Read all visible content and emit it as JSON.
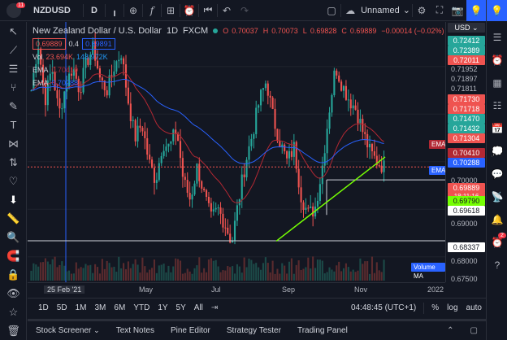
{
  "toolbar": {
    "symbol": "NZDUSD",
    "interval": "D",
    "layout_name": "Unnamed",
    "layout_caret": "⌄"
  },
  "notifications_count": "11",
  "legend": {
    "title": "New Zealand Dollar / U.S. Dollar",
    "interval": "1D",
    "exchange": "FXCM",
    "open_label": "O",
    "open": "0.70037",
    "high_label": "H",
    "high": "0.70073",
    "low_label": "L",
    "low": "0.69828",
    "close_label": "C",
    "close": "0.69889",
    "change": "−0.00014 (−0.02%)",
    "bid": "0.69889",
    "spread": "0.4",
    "ask": "0.69891",
    "vol_label": "Vol",
    "vol_value": "23.694K",
    "vol_ma": "148.972K",
    "ema1_label": "EMA",
    "ema1_value": "0.70410",
    "ema2_label": "EMA",
    "ema2_value": "0.70288"
  },
  "price_axis": {
    "currency": "USD",
    "red_labels": [
      "0.72011",
      "0.71730",
      "0.71718",
      "0.71304"
    ],
    "green_labels": [
      "0.72412",
      "0.72389",
      "0.71470",
      "0.71432"
    ],
    "plain_labels": [
      "0.71952",
      "0.71897",
      "0.71811"
    ],
    "ema_red": "0.70410",
    "ema_blue": "0.70288",
    "tick_700": "0.70000",
    "last_price": "0.69889",
    "countdown": "18:11:16",
    "green_last": "0.69790",
    "hline1": "0.69618",
    "tick_690": "0.69000",
    "hline2": "0.68337",
    "tick_680": "0.68000",
    "tick_675": "0.67500"
  },
  "overlay_tags": {
    "ema": "EMA",
    "volume_ma": "Volume MA"
  },
  "time_axis": [
    "25 Feb '21",
    "May",
    "Jul",
    "Sep",
    "Nov",
    "2022"
  ],
  "ranges": [
    "1D",
    "5D",
    "1M",
    "3M",
    "6M",
    "YTD",
    "1Y",
    "5Y",
    "All"
  ],
  "bottom_right": {
    "clock": "04:48:45 (UTC+1)",
    "percent": "%",
    "log": "log",
    "auto": "auto"
  },
  "panels": [
    "Stock Screener",
    "Text Notes",
    "Pine Editor",
    "Strategy Tester",
    "Trading Panel"
  ],
  "alerts_badge": "2",
  "colors": {
    "bg": "#131722",
    "up": "#26a69a",
    "down": "#ef5350",
    "ema_red": "#b22833",
    "ema_blue": "#2962ff",
    "trendline": "#76ff03",
    "hline": "#d1d4dc",
    "accent": "#2962ff"
  },
  "chart_data": {
    "type": "candlestick",
    "title": "New Zealand Dollar / U.S. Dollar",
    "symbol": "NZDUSD",
    "interval": "1D",
    "ylim": [
      0.675,
      0.728
    ],
    "x_ticks": [
      "25 Feb '21",
      "May",
      "Jul",
      "Sep",
      "Nov",
      "2022"
    ],
    "closing_path": [
      0.715,
      0.725,
      0.713,
      0.72,
      0.71,
      0.716,
      0.72,
      0.715,
      0.721,
      0.724,
      0.717,
      0.715,
      0.72,
      0.723,
      0.713,
      0.705,
      0.708,
      0.7,
      0.696,
      0.704,
      0.703,
      0.707,
      0.696,
      0.692,
      0.699,
      0.693,
      0.688,
      0.69,
      0.687,
      0.683,
      0.692,
      0.7,
      0.706,
      0.713,
      0.717,
      0.709,
      0.704,
      0.7,
      0.703,
      0.693,
      0.689,
      0.69,
      0.698,
      0.71,
      0.72,
      0.716,
      0.713,
      0.711,
      0.706,
      0.702,
      0.7,
      0.6989
    ],
    "ema_red": 0.7041,
    "ema_blue": 0.70288,
    "horizontal_lines": [
      0.69618,
      0.68337
    ],
    "trendline": [
      [
        0.6833,
        0.701
      ]
    ],
    "last": 0.69889
  }
}
